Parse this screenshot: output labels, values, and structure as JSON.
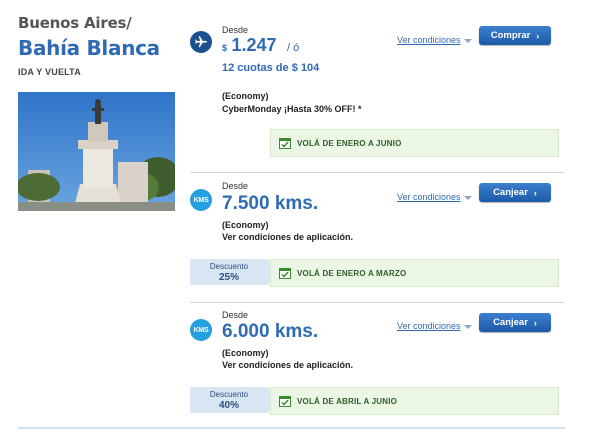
{
  "route": {
    "origin": "Buenos Aires/",
    "destination": "Bahía Blanca",
    "trip_type": "IDA Y VUELTA"
  },
  "offers": [
    {
      "desde": "Desde",
      "currency": "$",
      "price": "1.247",
      "or": "/ ó",
      "installments": "12 cuotas de $ 104",
      "class": "(Economy)",
      "promo": "CyberMonday ¡Hasta 30% OFF! *",
      "conditions": "Ver condiciones",
      "button": "Comprar",
      "period": "VOLÁ DE ENERO A JUNIO"
    },
    {
      "icon_text": "KMS",
      "desde": "Desde",
      "amount": "7.500 kms.",
      "class": "(Economy)",
      "note": "Ver condiciones de aplicación.",
      "conditions": "Ver condiciones",
      "button": "Canjear",
      "discount_label": "Descuento",
      "discount_value": "25%",
      "period": "VOLÁ DE ENERO A MARZO"
    },
    {
      "icon_text": "KMS",
      "desde": "Desde",
      "amount": "6.000 kms.",
      "class": "(Economy)",
      "note": "Ver condiciones de aplicación.",
      "conditions": "Ver condiciones",
      "button": "Canjear",
      "discount_label": "Descuento",
      "discount_value": "40%",
      "period": "VOLÁ DE ABRIL A JUNIO"
    }
  ],
  "icons": {
    "flight": "airplane-icon",
    "calendar": "calendar-check-icon",
    "chevron": "chevron-right-icon"
  }
}
